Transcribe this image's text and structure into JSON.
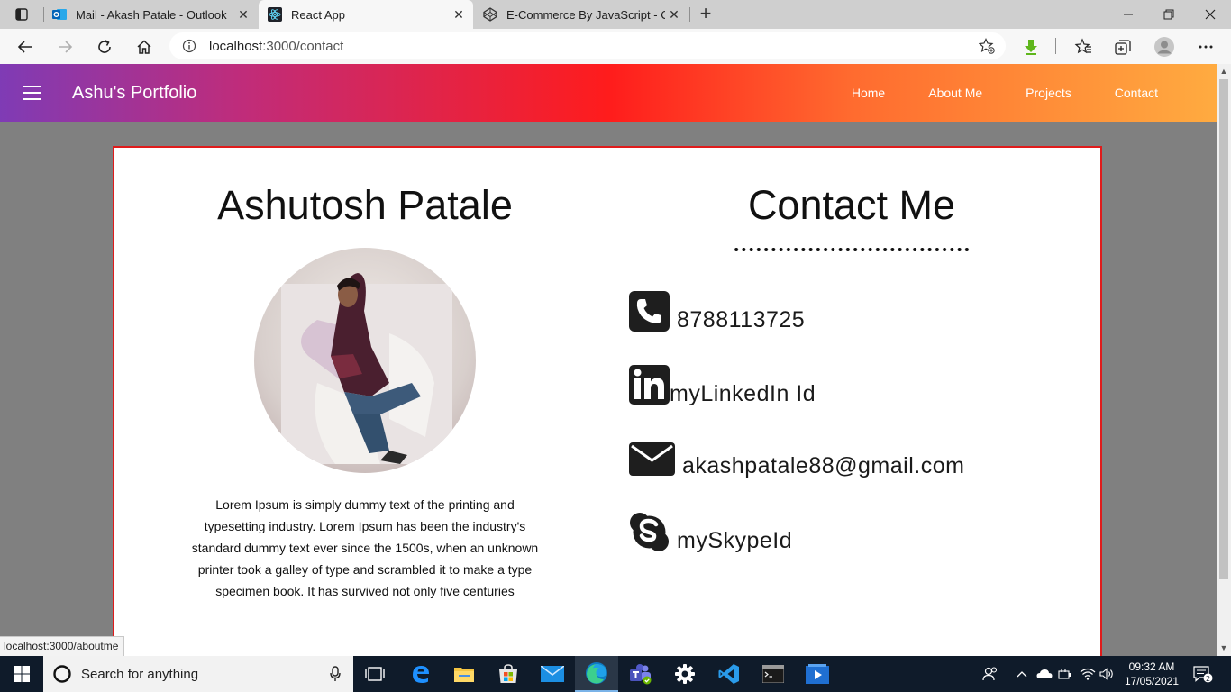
{
  "browser": {
    "tabs": [
      {
        "title": "Mail - Akash Patale - Outlook",
        "icon": "outlook-icon",
        "active": false
      },
      {
        "title": "React App",
        "icon": "react-icon",
        "active": true
      },
      {
        "title": "E-Commerce By JavaScript - Cod",
        "icon": "codepen-icon",
        "active": false
      }
    ],
    "url_host": "localhost",
    "url_path": ":3000/contact",
    "status_url": "localhost:3000/aboutme"
  },
  "appbar": {
    "brand": "Ashu's Portfolio",
    "nav": [
      "Home",
      "About Me",
      "Projects",
      "Contact"
    ]
  },
  "profile": {
    "name": "Ashutosh Patale",
    "bio": "Lorem Ipsum is simply dummy text of the printing and typesetting industry. Lorem Ipsum has been the industry's standard dummy text ever since the 1500s, when an unknown printer took a galley of type and scrambled it to make a type specimen book. It has survived not only five centuries"
  },
  "contact": {
    "title": "Contact Me",
    "phone": "8788113725",
    "linkedin": "myLinkedIn Id",
    "email": "akashpatale88@gmail.com",
    "skype": "mySkypeId"
  },
  "taskbar": {
    "search_placeholder": "Search for anything",
    "time": "09:32 AM",
    "date": "17/05/2021",
    "notification_count": "2"
  },
  "colors": {
    "card_border": "#e01b1b",
    "appbar_gradient": [
      "#7f3bb5",
      "#ff1c1c",
      "#ffab40"
    ]
  }
}
